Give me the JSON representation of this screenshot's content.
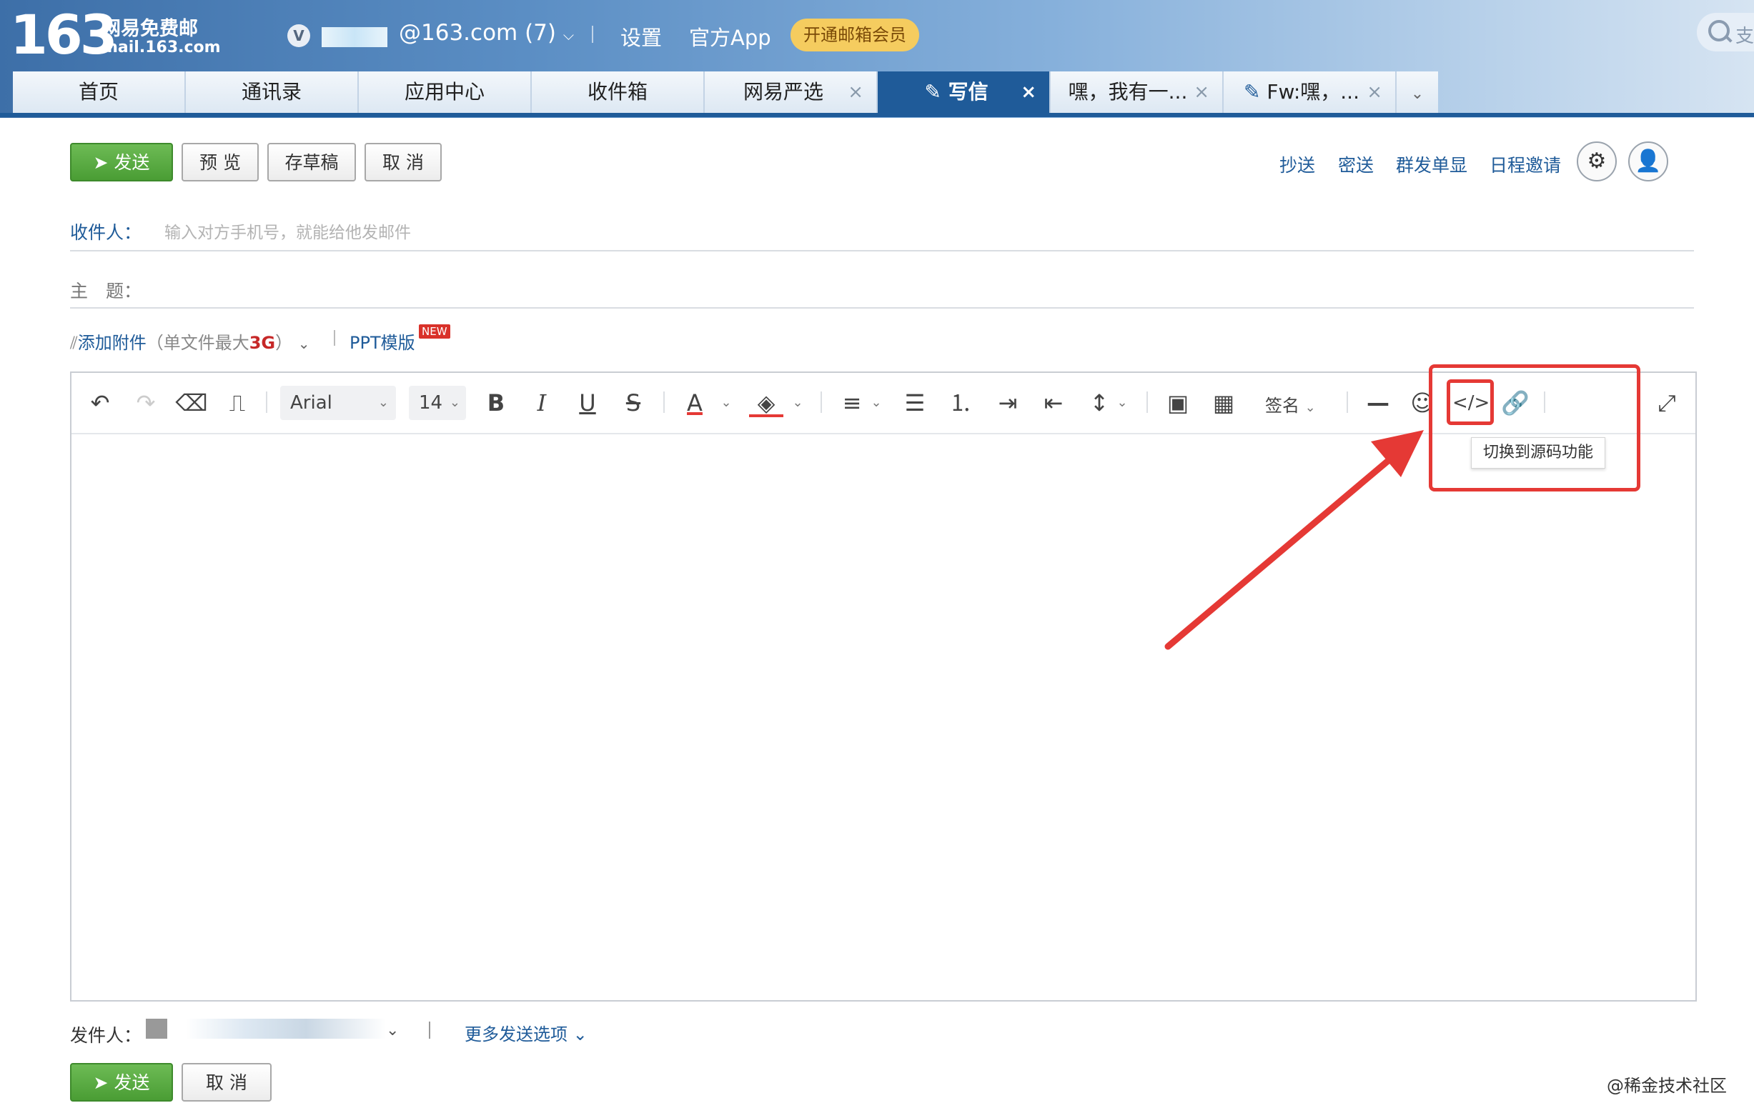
{
  "header": {
    "logo_num": "163",
    "logo_cn": "网易免费邮",
    "logo_url": "mail.163.com",
    "vip_badge": "V",
    "account": "@163.com (7)",
    "links": [
      "设置",
      "官方App"
    ],
    "vip_button": "开通邮箱会员",
    "search_partial": "支"
  },
  "tabs": [
    {
      "label": "首页",
      "closable": false,
      "active": false
    },
    {
      "label": "通讯录",
      "closable": false,
      "active": false
    },
    {
      "label": "应用中心",
      "closable": false,
      "active": false
    },
    {
      "label": "收件箱",
      "closable": false,
      "active": false
    },
    {
      "label": "网易严选",
      "closable": true,
      "active": false
    },
    {
      "label": "写信",
      "closable": true,
      "active": true,
      "icon": "compose-icon"
    },
    {
      "label": "嘿，我有一...",
      "closable": true,
      "active": false
    },
    {
      "label": "Fw:嘿，...",
      "closable": true,
      "active": false,
      "icon": "compose-icon"
    }
  ],
  "tab_close": "×",
  "toolbar": {
    "send": "发送",
    "preview": "预 览",
    "draft": "存草稿",
    "cancel": "取 消",
    "cc": "抄送",
    "bcc": "密送",
    "mass_single": "群发单显",
    "schedule": "日程邀请"
  },
  "fields": {
    "to_label": "收件人：",
    "to_placeholder": "输入对方手机号，就能给他发邮件",
    "subject_label": "主　题：",
    "attach_label": "添加附件",
    "attach_note_pre": "（单文件最大",
    "attach_note_size": "3G",
    "attach_note_post": "）",
    "ppt_label": "PPT模版",
    "new_badge": "NEW"
  },
  "editor": {
    "font_family": "Arial",
    "font_size": "14",
    "signature": "签名",
    "tooltip": "切换到源码功能"
  },
  "footer": {
    "sender_label": "发件人：",
    "more_options": "更多发送选项",
    "send": "发送",
    "cancel": "取 消",
    "watermark": "@稀金技术社区"
  },
  "colors": {
    "brand_blue": "#1f5b99",
    "send_green": "#4a9d34",
    "highlight_red": "#e53935",
    "vip_gold": "#f5cc5f"
  }
}
